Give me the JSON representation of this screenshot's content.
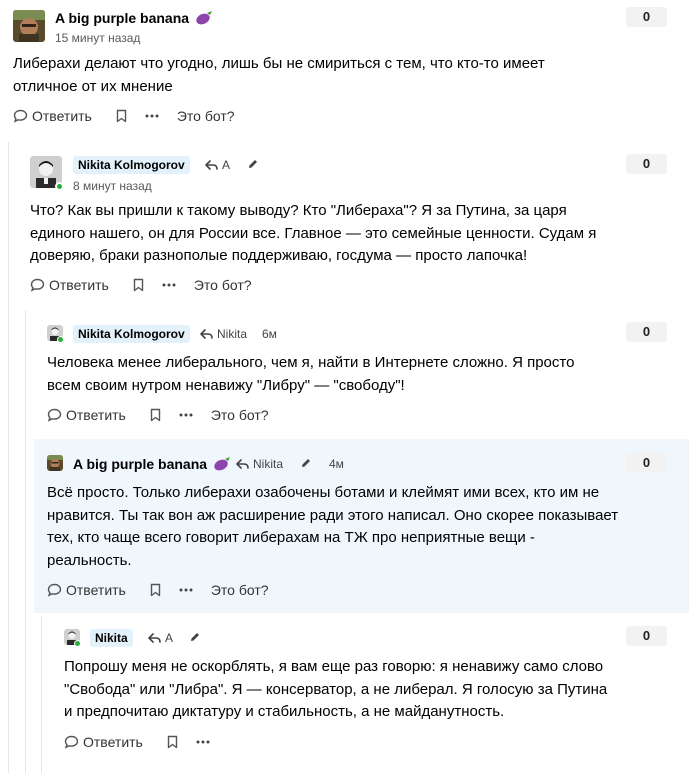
{
  "comments": [
    {
      "author": "A big purple banana",
      "author_emoji": "eggplant-icon",
      "time": "15 минут назад",
      "rating": "0",
      "text": "Либерахи делают что угодно, лишь бы не смириться с тем, что кто-то имеет отличное от их мнение",
      "actions": {
        "reply": "Ответить",
        "bot": "Это бот?"
      }
    },
    {
      "author": "Nikita Kolmogorov",
      "reply_to": "A",
      "time": "8 минут назад",
      "rating": "0",
      "text": "Что? Как вы пришли к такому выводу? Кто \"Либераха\"? Я за Путина, за царя единого нашего, он для России все. Главное — это семейные ценности. Судам я доверяю, браки разнополые поддерживаю, госдума — просто лапочка!",
      "actions": {
        "reply": "Ответить",
        "bot": "Это бот?"
      }
    },
    {
      "author": "Nikita Kolmogorov",
      "reply_to": "Nikita",
      "time": "6м",
      "rating": "0",
      "text": "Человека менее либерального, чем я, найти в Интернете сложно. Я просто всем своим нутром ненавижу \"Либру\" — \"свободу\"!",
      "actions": {
        "reply": "Ответить",
        "bot": "Это бот?"
      }
    },
    {
      "author": "A big purple banana",
      "author_emoji": "eggplant-icon",
      "reply_to": "Nikita",
      "time": "4м",
      "rating": "0",
      "text": "Всё просто. Только либерахи озабочены ботами и клеймят ими всех, кто им не нравится.  Ты так вон аж расширение ради этого написал. Оно скорее показывает тех, кто чаще всего говорит либерахам на ТЖ про неприятные вещи - реальность.",
      "actions": {
        "reply": "Ответить",
        "bot": "Это бот?"
      }
    },
    {
      "author": "Nikita",
      "reply_to": "A",
      "rating": "0",
      "text": "Попрошу меня не оскорблять, я вам еще раз говорю: я ненавижу само слово \"Свобода\" или \"Либра\". Я — консерватор, а не либерал. Я голосую за Путина и предпочитаю диктатуру и стабильность, а не майданутность.",
      "actions": {
        "reply": "Ответить"
      }
    }
  ],
  "colors": {
    "highlight_bg": "#f0f7fc",
    "author_badge_bg": "#e3f2fa",
    "online": "#27ae3c",
    "rating_bg": "#f2f2f2"
  }
}
